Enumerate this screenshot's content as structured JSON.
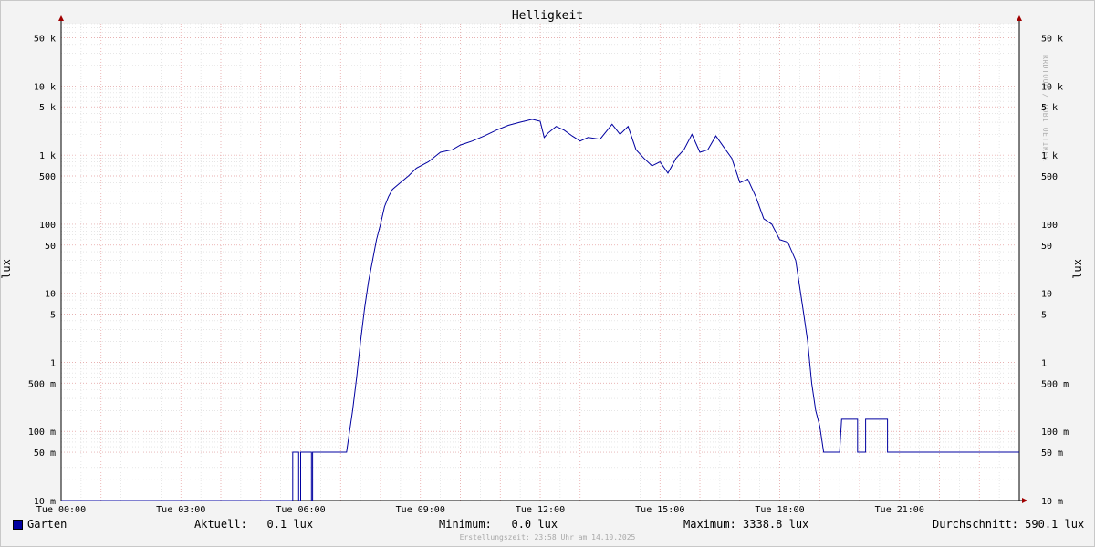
{
  "chart_data": {
    "type": "line",
    "title": "Helligkeit",
    "ylabel": "lux",
    "ylabel_right": "lux",
    "yscale": "log",
    "ylim": [
      0.01,
      80000
    ],
    "xlim_hours": [
      0,
      24
    ],
    "y_ticks": [
      {
        "v": 0.01,
        "label": "10 m"
      },
      {
        "v": 0.05,
        "label": "50 m"
      },
      {
        "v": 0.1,
        "label": "100 m"
      },
      {
        "v": 0.5,
        "label": "500 m"
      },
      {
        "v": 1,
        "label": "1"
      },
      {
        "v": 5,
        "label": "5"
      },
      {
        "v": 10,
        "label": "10"
      },
      {
        "v": 50,
        "label": "50"
      },
      {
        "v": 100,
        "label": "100"
      },
      {
        "v": 500,
        "label": "500"
      },
      {
        "v": 1000,
        "label": "1 k"
      },
      {
        "v": 5000,
        "label": "5 k"
      },
      {
        "v": 10000,
        "label": "10 k"
      },
      {
        "v": 50000,
        "label": "50 k"
      }
    ],
    "x_ticks": [
      {
        "h": 0,
        "label": "Tue 00:00"
      },
      {
        "h": 3,
        "label": "Tue 03:00"
      },
      {
        "h": 6,
        "label": "Tue 06:00"
      },
      {
        "h": 9,
        "label": "Tue 09:00"
      },
      {
        "h": 12,
        "label": "Tue 12:00"
      },
      {
        "h": 15,
        "label": "Tue 15:00"
      },
      {
        "h": 18,
        "label": "Tue 18:00"
      },
      {
        "h": 21,
        "label": "Tue 21:00"
      }
    ],
    "series": [
      {
        "name": "Garten",
        "color": "#0000a0",
        "x_hours": [
          0,
          5.8,
          5.8,
          5.95,
          5.95,
          6.0,
          6.0,
          6.27,
          6.27,
          6.3,
          6.3,
          7.15,
          7.2,
          7.3,
          7.4,
          7.5,
          7.6,
          7.7,
          7.8,
          7.9,
          8.0,
          8.1,
          8.2,
          8.3,
          8.5,
          8.7,
          8.9,
          9.2,
          9.5,
          9.8,
          10.0,
          10.3,
          10.6,
          10.9,
          11.2,
          11.5,
          11.8,
          12.0,
          12.1,
          12.2,
          12.4,
          12.6,
          12.8,
          13.0,
          13.2,
          13.5,
          13.8,
          14.0,
          14.2,
          14.4,
          14.6,
          14.8,
          15.0,
          15.2,
          15.4,
          15.6,
          15.8,
          16.0,
          16.2,
          16.4,
          16.6,
          16.8,
          17.0,
          17.2,
          17.4,
          17.6,
          17.8,
          18.0,
          18.2,
          18.4,
          18.6,
          18.7,
          18.8,
          18.9,
          19.0,
          19.1,
          19.2,
          19.3,
          19.4,
          19.5,
          19.55,
          19.95,
          19.95,
          20.15,
          20.15,
          20.7,
          20.7,
          20.9,
          20.9,
          24.0
        ],
        "values": [
          0.01,
          0.01,
          0.05,
          0.05,
          0.01,
          0.01,
          0.05,
          0.05,
          0.01,
          0.01,
          0.05,
          0.05,
          0.08,
          0.2,
          0.6,
          2,
          6,
          15,
          30,
          60,
          100,
          180,
          250,
          320,
          400,
          500,
          650,
          800,
          1100,
          1200,
          1400,
          1600,
          1900,
          2300,
          2700,
          3000,
          3300,
          3100,
          1800,
          2100,
          2600,
          2300,
          1900,
          1600,
          1800,
          1700,
          2800,
          2000,
          2600,
          1200,
          900,
          700,
          800,
          550,
          900,
          1200,
          2000,
          1100,
          1200,
          1900,
          1300,
          900,
          400,
          450,
          250,
          120,
          100,
          60,
          55,
          30,
          5,
          2,
          0.5,
          0.2,
          0.12,
          0.05,
          0.05,
          0.05,
          0.05,
          0.05,
          0.15,
          0.15,
          0.05,
          0.05,
          0.15,
          0.15,
          0.05,
          0.05,
          0.05,
          0.05
        ]
      }
    ]
  },
  "legend": {
    "series_name": "Garten",
    "current": "Aktuell:   0.1 lux",
    "minimum": "Minimum:   0.0 lux",
    "maximum": "Maximum: 3338.8 lux",
    "average": "Durchschnitt: 590.1 lux"
  },
  "footer": "Erstellungszeit: 23:58 Uhr am 14.10.2025",
  "watermark": "RRDTOOL / TOBI OETIKER"
}
